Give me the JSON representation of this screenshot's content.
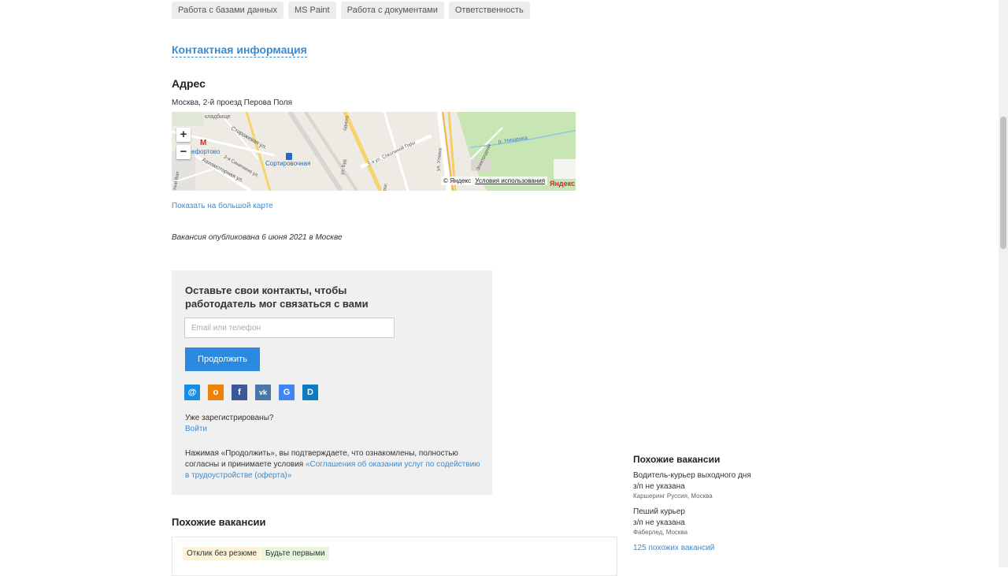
{
  "tags": [
    "Работа с базами данных",
    "MS Paint",
    "Работа с документами",
    "Ответственность"
  ],
  "contact_link": "Контактная информация",
  "address": {
    "heading": "Адрес",
    "text": "Москва, 2-й проезд Перова Поля",
    "map_labels": {
      "cemetery": "кладбище",
      "metro": "ефортово",
      "station": "Сортировочная",
      "street1": "Сторожевая ул.",
      "street2": "Авиамоторная ул.",
      "street3": "2-я Синичкина ул.",
      "street4": "5-я ул. Соколиной Горы",
      "street5": "ул. Буд",
      "street6": "ул. Уткина",
      "street7": "Электродная",
      "river": "р. Нищенка",
      "edge1": "ный Вал",
      "edge2": "одного",
      "edge3": "прос"
    },
    "map_copyright": "© Яндекс",
    "map_terms": "Условия использования",
    "map_logo": "Яндекс",
    "show_big_map": "Показать на большой карте"
  },
  "published": "Вакансия опубликована 6 июня 2021 в Москве",
  "contact_form": {
    "title": "Оставьте свои контакты, чтобы работодатель мог связаться с вами",
    "email_placeholder": "Email или телефон",
    "continue": "Продолжить",
    "social": [
      {
        "name": "mail",
        "glyph": "@",
        "color": "#168de2"
      },
      {
        "name": "ok",
        "glyph": "о",
        "color": "#ee8208"
      },
      {
        "name": "facebook",
        "glyph": "f",
        "color": "#3b5998"
      },
      {
        "name": "vk",
        "glyph": "vk",
        "color": "#4a76a8"
      },
      {
        "name": "google",
        "glyph": "G",
        "color": "#4285f4"
      },
      {
        "name": "d",
        "glyph": "D",
        "color": "#0d7bbf"
      }
    ],
    "registered": "Уже зарегистрированы?",
    "login": "Войти",
    "terms_prefix": "Нажимая «Продолжить», вы подтверждаете, что ознакомлены, полностью согласны и принимаете условия ",
    "terms_link": "«Соглашения об оказании услуг по содействию в трудоустройстве (оферта)»"
  },
  "similar": {
    "heading": "Похожие вакансии",
    "badges": [
      {
        "label": "Отклик без резюме",
        "color": "#fcf3d9"
      },
      {
        "label": "Будьте первыми",
        "color": "#e8f6de"
      }
    ]
  },
  "right_similar": {
    "heading": "Похожие вакансии",
    "items": [
      {
        "title": "Водитель-курьер выходного дня",
        "salary": "з/п не указана",
        "company": "Каршеринг Руссия, Москва"
      },
      {
        "title": "Пеший курьер",
        "salary": "з/п не указана",
        "company": "Фаберлед, Москва"
      }
    ],
    "more": "125 похожих вакансий"
  }
}
